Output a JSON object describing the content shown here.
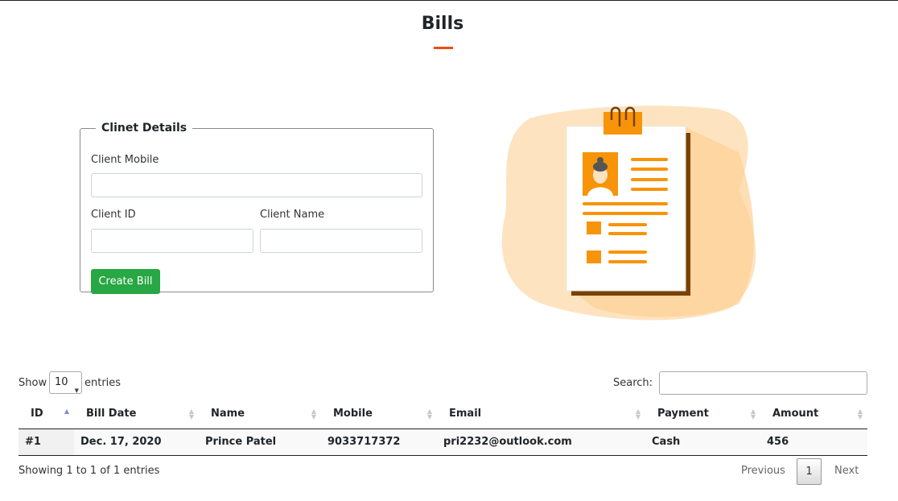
{
  "page": {
    "title": "Bills"
  },
  "client_form": {
    "legend": "Clinet Details",
    "mobile_label": "Client Mobile",
    "mobile_value": "",
    "id_label": "Client ID",
    "id_value": "",
    "name_label": "Client Name",
    "name_value": "",
    "create_button": "Create Bill",
    "create_button_color": "#28a745"
  },
  "illustration": {
    "icon": "client-document-icon",
    "accent_color": "#f7940a",
    "blob_color": "#fde3c0"
  },
  "table_controls": {
    "show_label": "Show",
    "entries_value": "10",
    "entries_label": "entries",
    "search_label": "Search:",
    "search_value": ""
  },
  "table": {
    "columns": [
      "ID",
      "Bill Date",
      "Name",
      "Mobile",
      "Email",
      "Payment",
      "Amount"
    ],
    "rows": [
      [
        "#1",
        "Dec. 17, 2020",
        "Prince Patel",
        "9033717372",
        "pri2232@outlook.com",
        "Cash",
        "456"
      ]
    ]
  },
  "footer": {
    "info": "Showing 1 to 1 of 1 entries",
    "previous": "Previous",
    "current_page": "1",
    "next": "Next"
  },
  "colors": {
    "title_underline": "#ec4d13"
  }
}
